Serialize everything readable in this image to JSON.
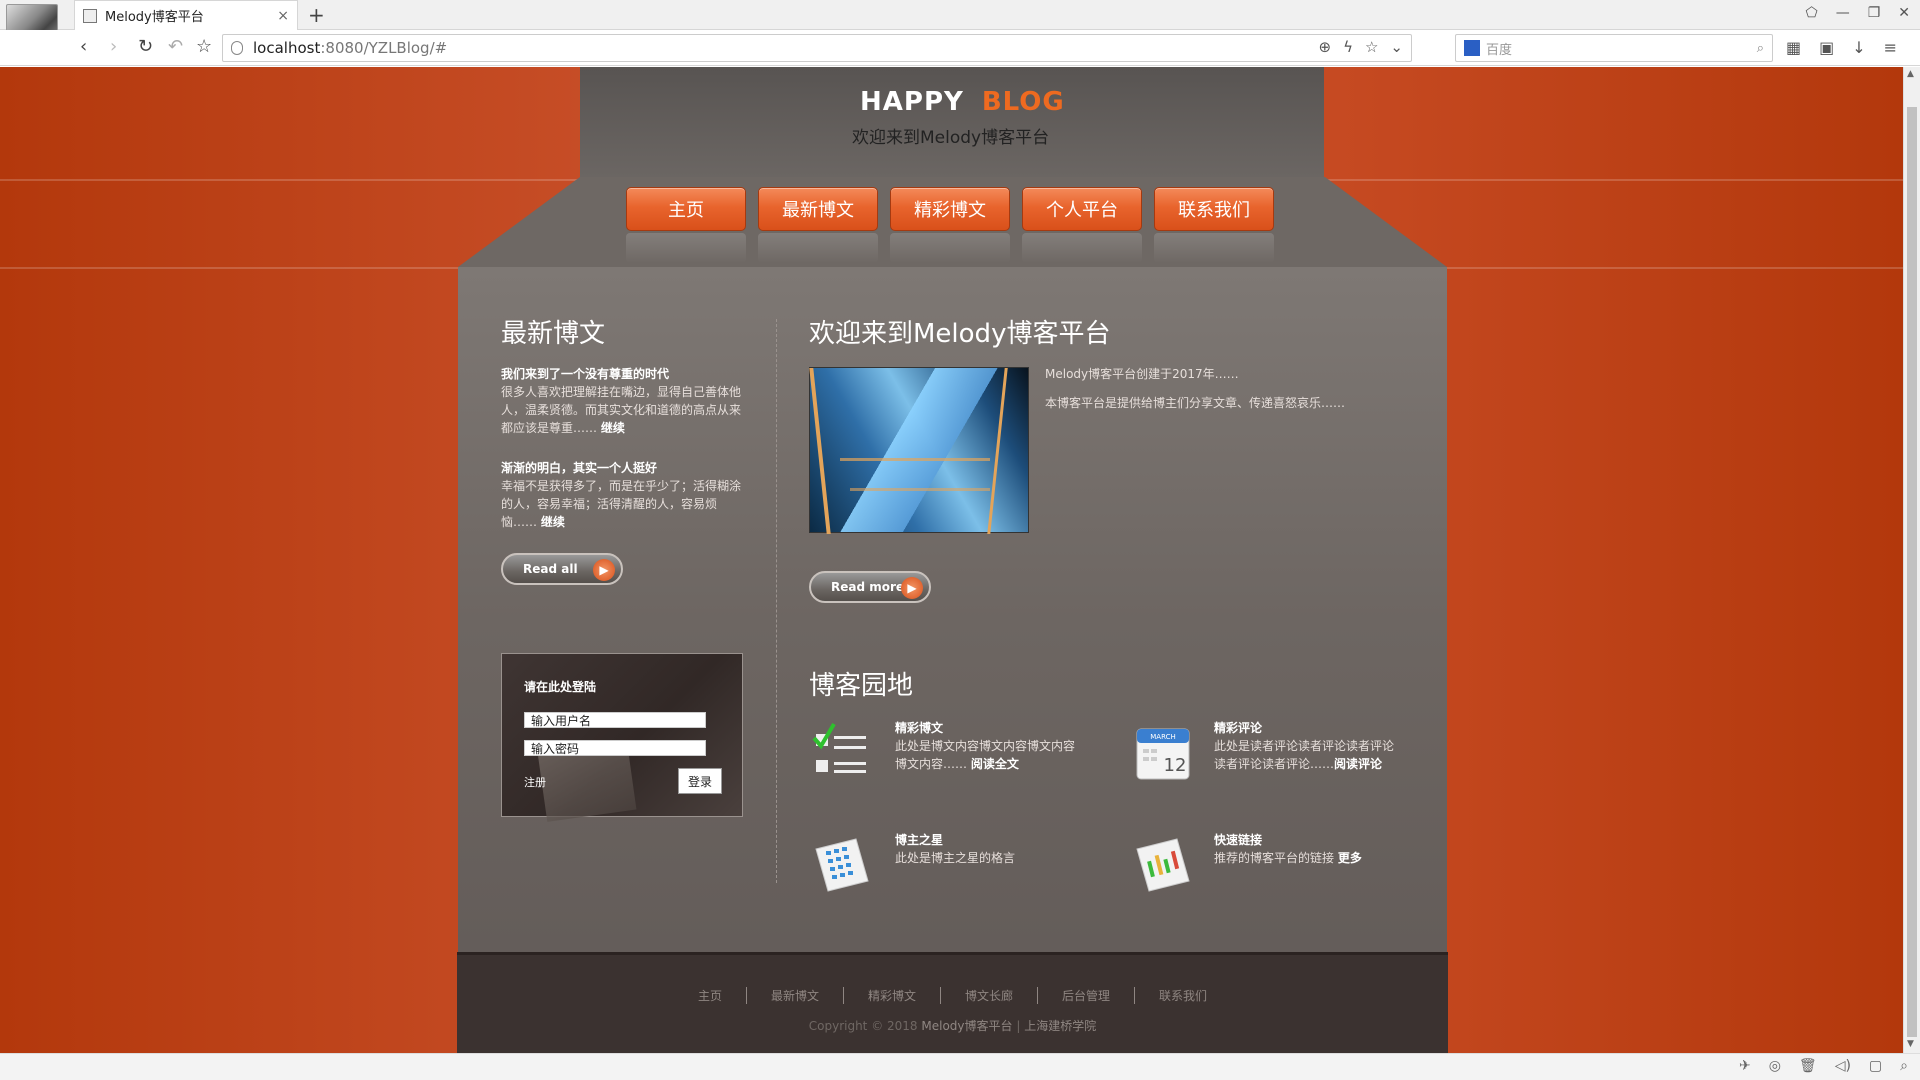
{
  "browser": {
    "tab_title": "Melody博客平台",
    "tab_close": "×",
    "new_tab": "+",
    "url_host": "localhost",
    "url_rest": ":8080/YZLBlog/#",
    "search_placeholder": "百度",
    "win_controls": [
      "⬠",
      "—",
      "❐",
      "✕"
    ],
    "nav_icons": [
      "‹",
      "›",
      "↻",
      "↶",
      "☆"
    ],
    "addr_icons": [
      "⊕",
      "ϟ",
      "☆",
      "⌄"
    ],
    "ext_icons": [
      "▦",
      "▣",
      "↓",
      "≡"
    ]
  },
  "header": {
    "logo_a": "HAPPY",
    "logo_b": "BLOG",
    "subtitle": "欢迎来到Melody博客平台"
  },
  "nav": [
    "主页",
    "最新博文",
    "精彩博文",
    "个人平台",
    "联系我们"
  ],
  "latest": {
    "heading": "最新博文",
    "posts": [
      {
        "title": "我们来到了一个没有尊重的时代",
        "text": "很多人喜欢把理解挂在嘴边，显得自己善体他人，温柔贤德。而其实文化和道德的高点从来都应该是尊重……",
        "more": "继续"
      },
      {
        "title": "渐渐的明白，其实一个人挺好",
        "text": "幸福不是获得多了，而是在乎少了；活得糊涂的人，容易幸福；活得清醒的人，容易烦恼……",
        "more": "继续"
      }
    ],
    "read_all": "Read all"
  },
  "login": {
    "title": "请在此处登陆",
    "username_value": "输入用户名",
    "password_value": "输入密码",
    "register": "注册",
    "submit": "登录"
  },
  "welcome": {
    "heading": "欢迎来到Melody博客平台",
    "line1": "Melody博客平台创建于2017年……",
    "line2": "本博客平台是提供给博主们分享文章、传递喜怒哀乐……",
    "read_more": "Read more"
  },
  "garden": {
    "heading": "博客园地",
    "items": [
      {
        "icon": "checklist-icon",
        "title": "精彩博文",
        "text1": "此处是博文内容博文内容博文内容",
        "text2": "博文内容……",
        "more": "阅读全文"
      },
      {
        "icon": "calendar-icon",
        "title": "精彩评论",
        "text1": "此处是读者评论读者评论读者评论",
        "text2": "读者评论读者评论……",
        "more": "阅读评论",
        "calendar_month": "MARCH",
        "calendar_day": "12"
      },
      {
        "icon": "table-sheet-icon",
        "title": "博主之星",
        "text1": "此处是博主之星的格言",
        "text2": "",
        "more": ""
      },
      {
        "icon": "chart-sheet-icon",
        "title": "快速链接",
        "text1": "推荐的博客平台的链接",
        "text2": "",
        "more": "更多"
      }
    ]
  },
  "footer": {
    "links": [
      "主页",
      "最新博文",
      "精彩博文",
      "博文长廊",
      "后台管理",
      "联系我们"
    ],
    "copyright_prefix": "Copyright © 2018",
    "copyright_name": "Melody博客平台",
    "copyright_sep": "|",
    "copyright_school": "上海建桥学院"
  },
  "colors": {
    "page_bg": "#b53a10",
    "nav_button": "#e8642d",
    "logo_accent": "#ee6a20",
    "panel": "#6d6662",
    "footer": "#3b3230"
  }
}
